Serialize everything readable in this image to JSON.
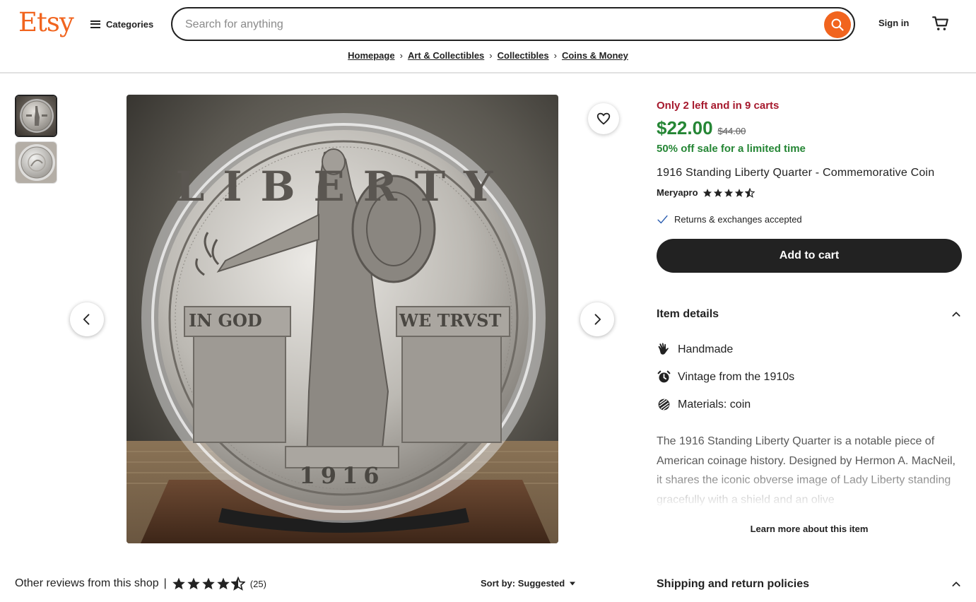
{
  "header": {
    "logo": "Etsy",
    "categories_label": "Categories",
    "search_placeholder": "Search for anything",
    "search_value": "",
    "signin_label": "Sign in"
  },
  "breadcrumb": [
    "Homepage",
    "Art & Collectibles",
    "Collectibles",
    "Coins & Money"
  ],
  "gallery": {
    "thumbnails": [
      "coin-front-thumbnail",
      "coin-angle-thumbnail"
    ],
    "main_image": "standing-liberty-quarter-in-capsule",
    "coin_text": {
      "top": "LIBERTY",
      "left": "IN GOD",
      "right": "WE TRVST",
      "date": "1916"
    }
  },
  "product": {
    "stock_text": "Only 2 left and in 9 carts",
    "price": "$22.00",
    "original_price": "$44.00",
    "sale_text": "50% off sale for a limited time",
    "title": "1916 Standing Liberty Quarter - Commemorative Coin",
    "shop_name": "Meryapro",
    "shop_rating": 4.5,
    "returns_text": "Returns & exchanges accepted",
    "add_to_cart_label": "Add to cart"
  },
  "item_details": {
    "heading": "Item details",
    "rows": [
      {
        "icon": "hand-icon",
        "label": "Handmade"
      },
      {
        "icon": "alarm-clock-icon",
        "label": "Vintage from the 1910s"
      },
      {
        "icon": "materials-icon",
        "label": "Materials: coin"
      }
    ],
    "description": "The 1916 Standing Liberty Quarter is a notable piece of American coinage history. Designed by Hermon A. MacNeil, it shares the iconic obverse image of Lady Liberty standing gracefully with a shield and an olive",
    "learn_more_label": "Learn more about this item"
  },
  "shipping": {
    "heading": "Shipping and return policies"
  },
  "reviews": {
    "heading": "Other reviews from this shop",
    "separator": "|",
    "rating": 4.5,
    "count_text": "(25)",
    "sort_label": "Sort by: Suggested"
  },
  "colors": {
    "brand": "#f1641e",
    "price_green": "#258635",
    "stock_red": "#a61a2e",
    "dark": "#222222"
  }
}
